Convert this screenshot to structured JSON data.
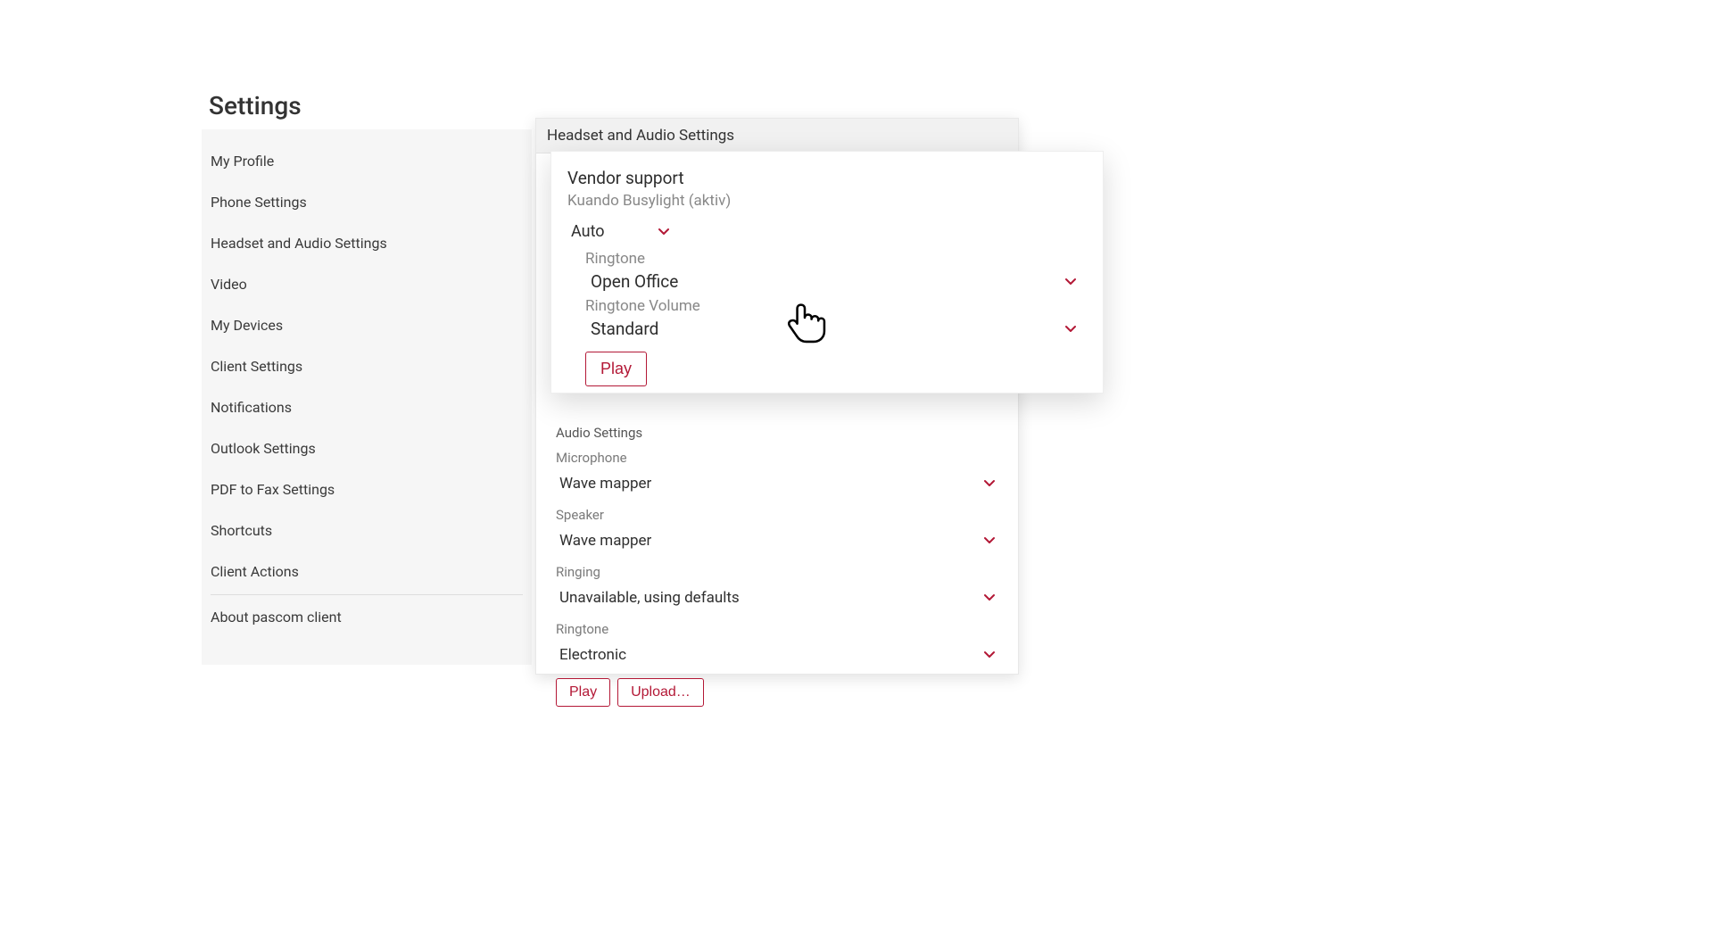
{
  "pageTitle": "Settings",
  "sidebar": {
    "items": [
      "My Profile",
      "Phone Settings",
      "Headset and Audio Settings",
      "Video",
      "My Devices",
      "Client Settings",
      "Notifications",
      "Outlook Settings",
      "PDF to Fax Settings",
      "Shortcuts",
      "Client Actions"
    ],
    "about": "About pascom client"
  },
  "backPanel": {
    "header": "Headset and Audio Settings",
    "audioSettings": {
      "heading": "Audio Settings",
      "microphone": {
        "label": "Microphone",
        "value": "Wave mapper"
      },
      "speaker": {
        "label": "Speaker",
        "value": "Wave mapper"
      },
      "ringing": {
        "label": "Ringing",
        "value": "Unavailable, using defaults"
      },
      "ringtone": {
        "label": "Ringtone",
        "value": "Electronic"
      }
    },
    "buttons": {
      "play": "Play",
      "upload": "Upload…"
    }
  },
  "overlay": {
    "vendorTitle": "Vendor support",
    "vendorSub": "Kuando Busylight  (aktiv)",
    "mode": "Auto",
    "ringtone": {
      "label": "Ringtone",
      "value": "Open Office"
    },
    "volume": {
      "label": "Ringtone Volume",
      "value": "Standard"
    },
    "play": "Play"
  },
  "colors": {
    "accent": "#b31836"
  }
}
